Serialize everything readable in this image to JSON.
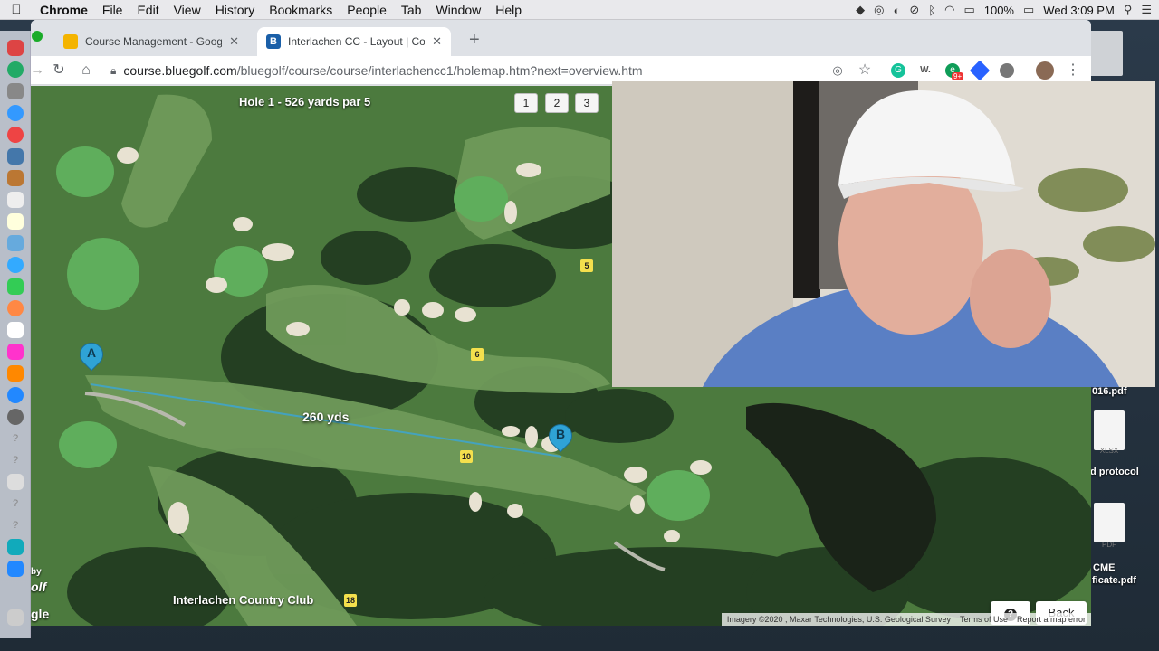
{
  "menubar": {
    "app": "Chrome",
    "items": [
      "File",
      "Edit",
      "View",
      "History",
      "Bookmarks",
      "People",
      "Tab",
      "Window",
      "Help"
    ],
    "battery": "100%",
    "clock": "Wed 3:09 PM"
  },
  "browser": {
    "tabs": [
      {
        "title": "Course Management - Google",
        "active": false
      },
      {
        "title": "Interlachen CC - Layout | Cour",
        "active": true
      }
    ],
    "url_host": "course.bluegolf.com",
    "url_path": "/bluegolf/course/course/interlachencc1/holemap.htm?next=overview.htm",
    "extension_badge": "9+"
  },
  "map": {
    "hole_title": "Hole 1 - 526 yards par 5",
    "hole_buttons": [
      "1",
      "2",
      "3"
    ],
    "distance_label": "260 yds",
    "pin_a": "A",
    "pin_b": "B",
    "hole_markers": [
      "5",
      "6",
      "10",
      "18"
    ],
    "club_name": "Interlachen Country Club",
    "help_label": "?",
    "back_label": "Back",
    "watermark_by": "by",
    "watermark_olf": "olf",
    "watermark_gle": "gle",
    "attribution": [
      "Imagery ©2020 , Maxar Technologies, U.S. Geological Survey",
      "Terms of Use",
      "Report a map error"
    ]
  },
  "desktop": {
    "files": [
      "016.pdf",
      "XLSX",
      "d protocol",
      "PDF",
      "CME",
      "ficate.pdf"
    ]
  },
  "colors": {
    "fairway": "#6f9a5a",
    "rough": "#4c7a3e",
    "trees": "#243f22",
    "green": "#5fae5c",
    "sand": "#e8e2d2",
    "water": "#1a2318",
    "pin": "#2fa3d6",
    "shirt": "#5a7fc4"
  }
}
